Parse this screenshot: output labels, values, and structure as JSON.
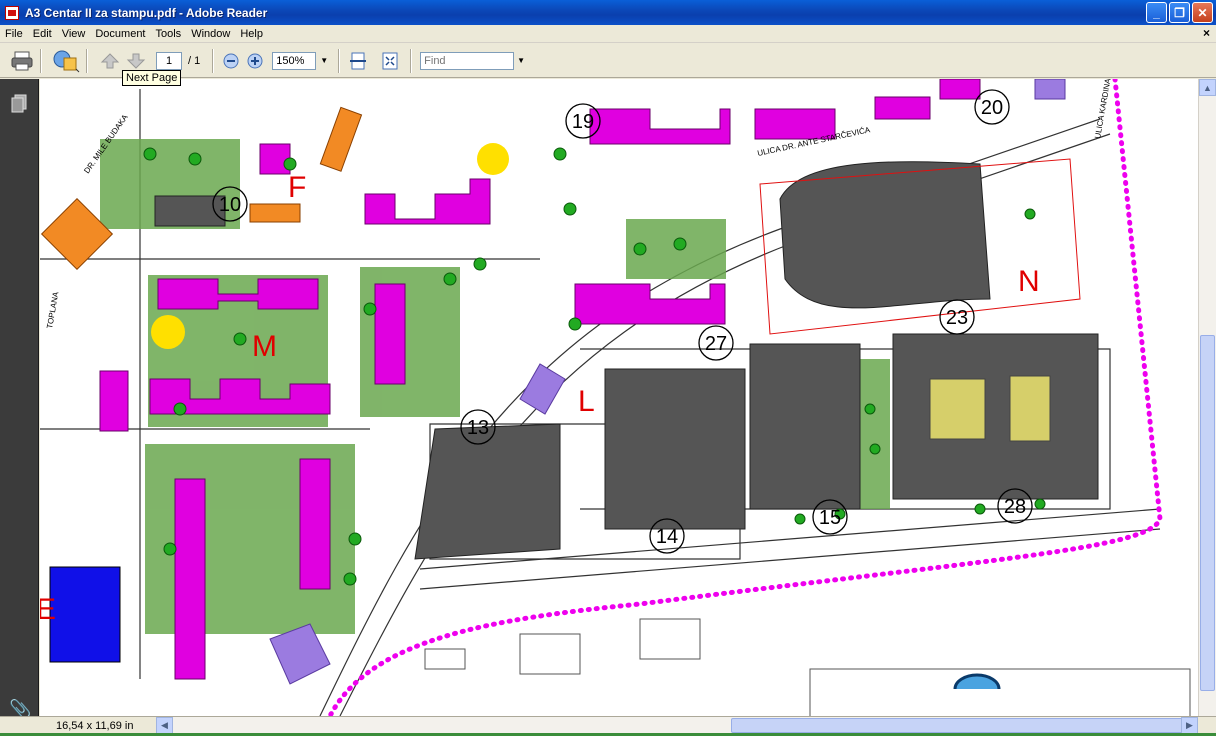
{
  "window": {
    "title": "A3 Centar II za stampu.pdf - Adobe Reader"
  },
  "menu": {
    "items": [
      "File",
      "Edit",
      "View",
      "Document",
      "Tools",
      "Window",
      "Help"
    ]
  },
  "toolbar": {
    "page_current": "1",
    "page_total": "/ 1",
    "zoom": "150%",
    "find_placeholder": "Find",
    "tooltip": "Next Page"
  },
  "status": {
    "page_size": "16,54 x 11,69 in"
  },
  "map": {
    "zone_letters": [
      "F",
      "M",
      "L",
      "N",
      "E"
    ],
    "circle_numbers": [
      "19",
      "20",
      "10",
      "23",
      "27",
      "13",
      "14",
      "15",
      "28"
    ],
    "street_labels": [
      "ULICA DR. ANTE STARČEVIĆA",
      "ULICA KARDINALA",
      "DR. MILE BUDAKA",
      "TOPLANA"
    ],
    "colors": {
      "residential": "#e000e0",
      "commercial": "#555555",
      "boundary": "#ee00ee",
      "green": "#22aa22",
      "zone_letter": "#e00000"
    }
  }
}
